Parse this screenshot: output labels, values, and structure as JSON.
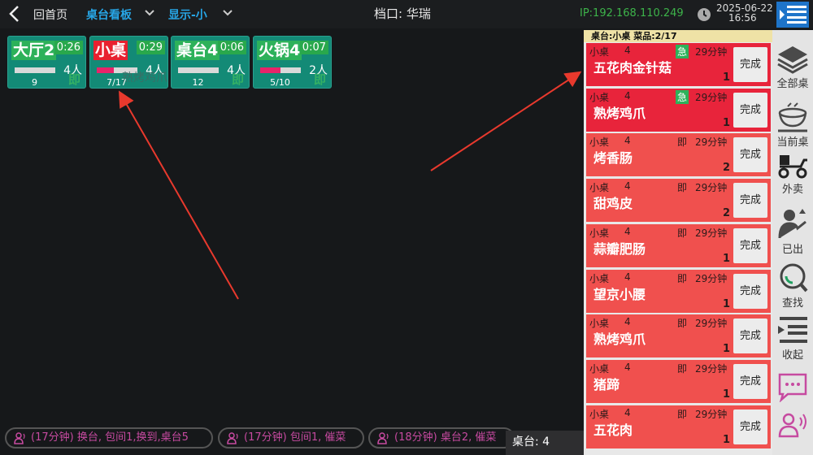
{
  "header": {
    "home_label": "回首页",
    "board_label": "桌台看板",
    "mode_label": "显示-小",
    "stall_label": "档口: 华瑞",
    "ip_label": "IP:192.168.110.249",
    "date": "2025-06-22",
    "time": "16:56"
  },
  "tables": [
    {
      "name": "大厅2",
      "time": "0:26",
      "guests": "4人",
      "count": "9",
      "progress": 0,
      "badge": "即",
      "alert": false
    },
    {
      "name": "小桌",
      "time": "0:29",
      "guests": "4人",
      "count": "7/17",
      "progress": 0.41,
      "badge": "",
      "alert": true
    },
    {
      "name": "桌台4",
      "time": "0:06",
      "guests": "4人",
      "count": "12",
      "progress": 0,
      "badge": "即",
      "alert": false
    },
    {
      "name": "火锅4",
      "time": "0:07",
      "guests": "2人",
      "count": "5/10",
      "progress": 0.5,
      "badge": "即",
      "alert": false
    }
  ],
  "ghost_text": "熟烤鸡爪",
  "panel": {
    "header": "桌台:小桌  菜品:2/17",
    "orders": [
      {
        "table": "小桌",
        "guests": "4",
        "flag": "急",
        "flag_type": "urgent",
        "wait": "29分钟",
        "dish": "五花肉金针菇",
        "qty": "1",
        "done": "完成",
        "color": "#e8243b"
      },
      {
        "table": "小桌",
        "guests": "4",
        "flag": "急",
        "flag_type": "urgent",
        "wait": "29分钟",
        "dish": "熟烤鸡爪",
        "qty": "1",
        "done": "完成",
        "color": "#e8243b"
      },
      {
        "table": "小桌",
        "guests": "4",
        "flag": "即",
        "flag_type": "now",
        "wait": "29分钟",
        "dish": "烤香肠",
        "qty": "2",
        "done": "完成",
        "color": "#f0504e"
      },
      {
        "table": "小桌",
        "guests": "4",
        "flag": "即",
        "flag_type": "now",
        "wait": "29分钟",
        "dish": "甜鸡皮",
        "qty": "2",
        "done": "完成",
        "color": "#f0504e"
      },
      {
        "table": "小桌",
        "guests": "4",
        "flag": "即",
        "flag_type": "now",
        "wait": "29分钟",
        "dish": "蒜瓣肥肠",
        "qty": "1",
        "done": "完成",
        "color": "#f0504e"
      },
      {
        "table": "小桌",
        "guests": "4",
        "flag": "即",
        "flag_type": "now",
        "wait": "29分钟",
        "dish": "望京小腰",
        "qty": "1",
        "done": "完成",
        "color": "#f0504e"
      },
      {
        "table": "小桌",
        "guests": "4",
        "flag": "即",
        "flag_type": "now",
        "wait": "29分钟",
        "dish": "熟烤鸡爪",
        "qty": "1",
        "done": "完成",
        "color": "#f0504e"
      },
      {
        "table": "小桌",
        "guests": "4",
        "flag": "即",
        "flag_type": "now",
        "wait": "29分钟",
        "dish": "猪蹄",
        "qty": "1",
        "done": "完成",
        "color": "#f0504e"
      },
      {
        "table": "小桌",
        "guests": "4",
        "flag": "即",
        "flag_type": "now",
        "wait": "29分钟",
        "dish": "五花肉",
        "qty": "1",
        "done": "完成",
        "color": "#f0504e"
      }
    ]
  },
  "sidebar": {
    "all_tables": "全部桌",
    "current_table": "当前桌",
    "takeout": "外卖",
    "served": "已出",
    "search": "查找",
    "collapse": "收起"
  },
  "messages": [
    "(17分钟) 换台, 包间1,换到,桌台5",
    "(17分钟) 包间1, 催菜",
    "(18分钟) 桌台2, 催菜"
  ],
  "table_count_label": "桌台: 4",
  "colors": {
    "accent_blue": "#27a6e6",
    "ip_green": "#3db34a",
    "card_teal": "#138a76",
    "urgent_red": "#e8243b",
    "order_red": "#f0504e"
  }
}
